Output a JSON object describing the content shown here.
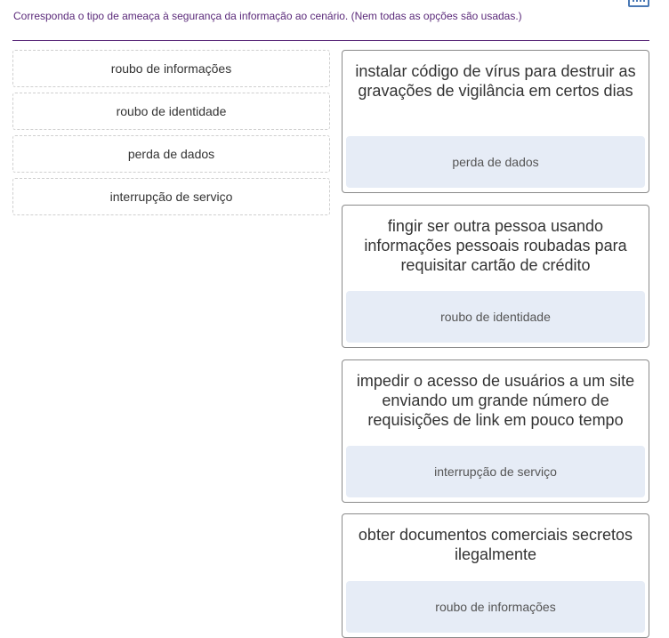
{
  "instruction": "Corresponda o tipo de ameaça à segurança da informação ao cenário. (Nem todas as opções são usadas.)",
  "options": [
    {
      "label": "roubo de informações"
    },
    {
      "label": "roubo de identidade"
    },
    {
      "label": "perda de dados"
    },
    {
      "label": "interrupção de serviço"
    }
  ],
  "scenarios": [
    {
      "text": "instalar código de vírus para destruir as gravações de vigilância em certos dias",
      "answer": "perda de dados"
    },
    {
      "text": "fingir ser outra pessoa usando informações pessoais roubadas para requisitar cartão de crédito",
      "answer": "roubo de identidade"
    },
    {
      "text": "impedir o acesso de usuários a um site enviando um grande número de requisições de link em pouco tempo",
      "answer": "interrupção de serviço"
    },
    {
      "text": "obter documentos comerciais secretos ilegalmente",
      "answer": "roubo de informações"
    }
  ],
  "icons": {
    "keyboard": "keyboard-icon"
  },
  "colors": {
    "accent": "#5b2a7a",
    "drop_zone": "#e6ecf6"
  }
}
